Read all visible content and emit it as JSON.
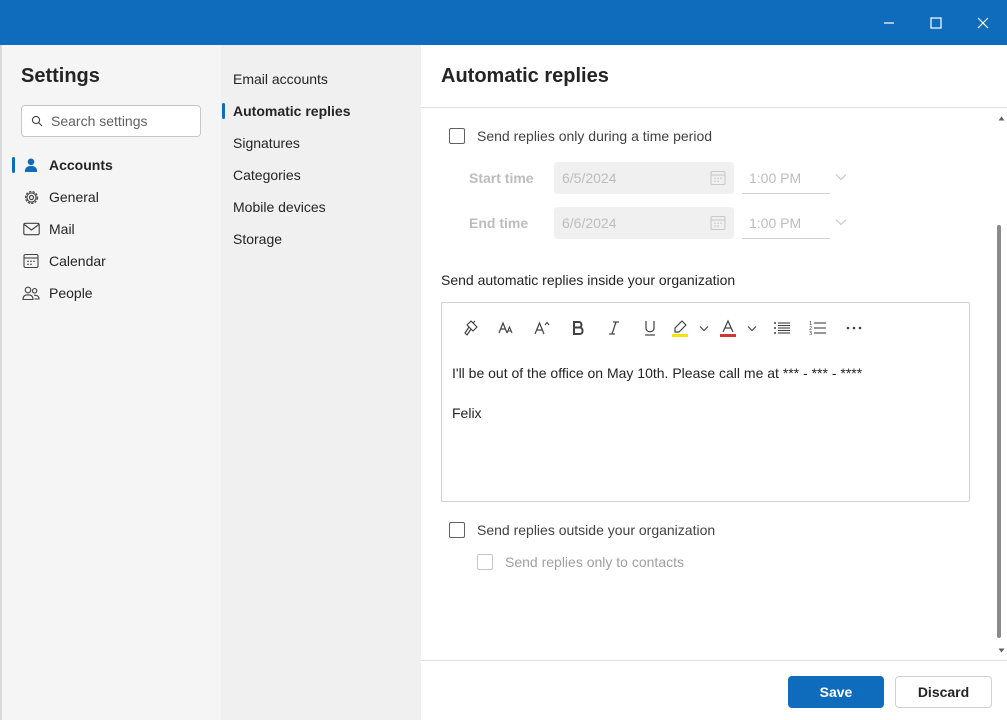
{
  "window": {
    "controls": [
      "minimize-icon",
      "maximize-icon",
      "close-icon"
    ]
  },
  "sidebar": {
    "title": "Settings",
    "search_placeholder": "Search settings",
    "items": [
      {
        "label": "Accounts",
        "icon": "person-icon",
        "active": true
      },
      {
        "label": "General",
        "icon": "gear-icon"
      },
      {
        "label": "Mail",
        "icon": "mail-icon"
      },
      {
        "label": "Calendar",
        "icon": "calendar-icon"
      },
      {
        "label": "People",
        "icon": "people-icon"
      }
    ]
  },
  "subnav": {
    "items": [
      {
        "label": "Email accounts"
      },
      {
        "label": "Automatic replies",
        "active": true
      },
      {
        "label": "Signatures"
      },
      {
        "label": "Categories"
      },
      {
        "label": "Mobile devices"
      },
      {
        "label": "Storage"
      }
    ]
  },
  "main": {
    "title": "Automatic replies",
    "time_period_label": "Send replies only during a time period",
    "time_period_checked": false,
    "start": {
      "label": "Start time",
      "date": "6/5/2024",
      "time": "1:00 PM"
    },
    "end": {
      "label": "End time",
      "date": "6/6/2024",
      "time": "1:00 PM"
    },
    "inside_label": "Send automatic replies inside your organization",
    "toolbar": [
      "format-painter-icon",
      "font-size-icon",
      "grow-font-icon",
      "bold-icon",
      "italic-icon",
      "underline-icon",
      "highlight-icon",
      "font-color-icon",
      "bullets-icon",
      "numbering-icon",
      "more-icon"
    ],
    "message": {
      "line1": "I'll be out of the office on May 10th. Please call me at *** - *** - ****",
      "line2": "Felix"
    },
    "outside_label": "Send replies outside your organization",
    "outside_checked": false,
    "contacts_label": "Send replies only to contacts",
    "contacts_checked": false
  },
  "footer": {
    "save_label": "Save",
    "discard_label": "Discard"
  },
  "colors": {
    "accent": "#0f6cbd",
    "highlight_bar": "#f2e600",
    "font_color_bar": "#d13438"
  }
}
